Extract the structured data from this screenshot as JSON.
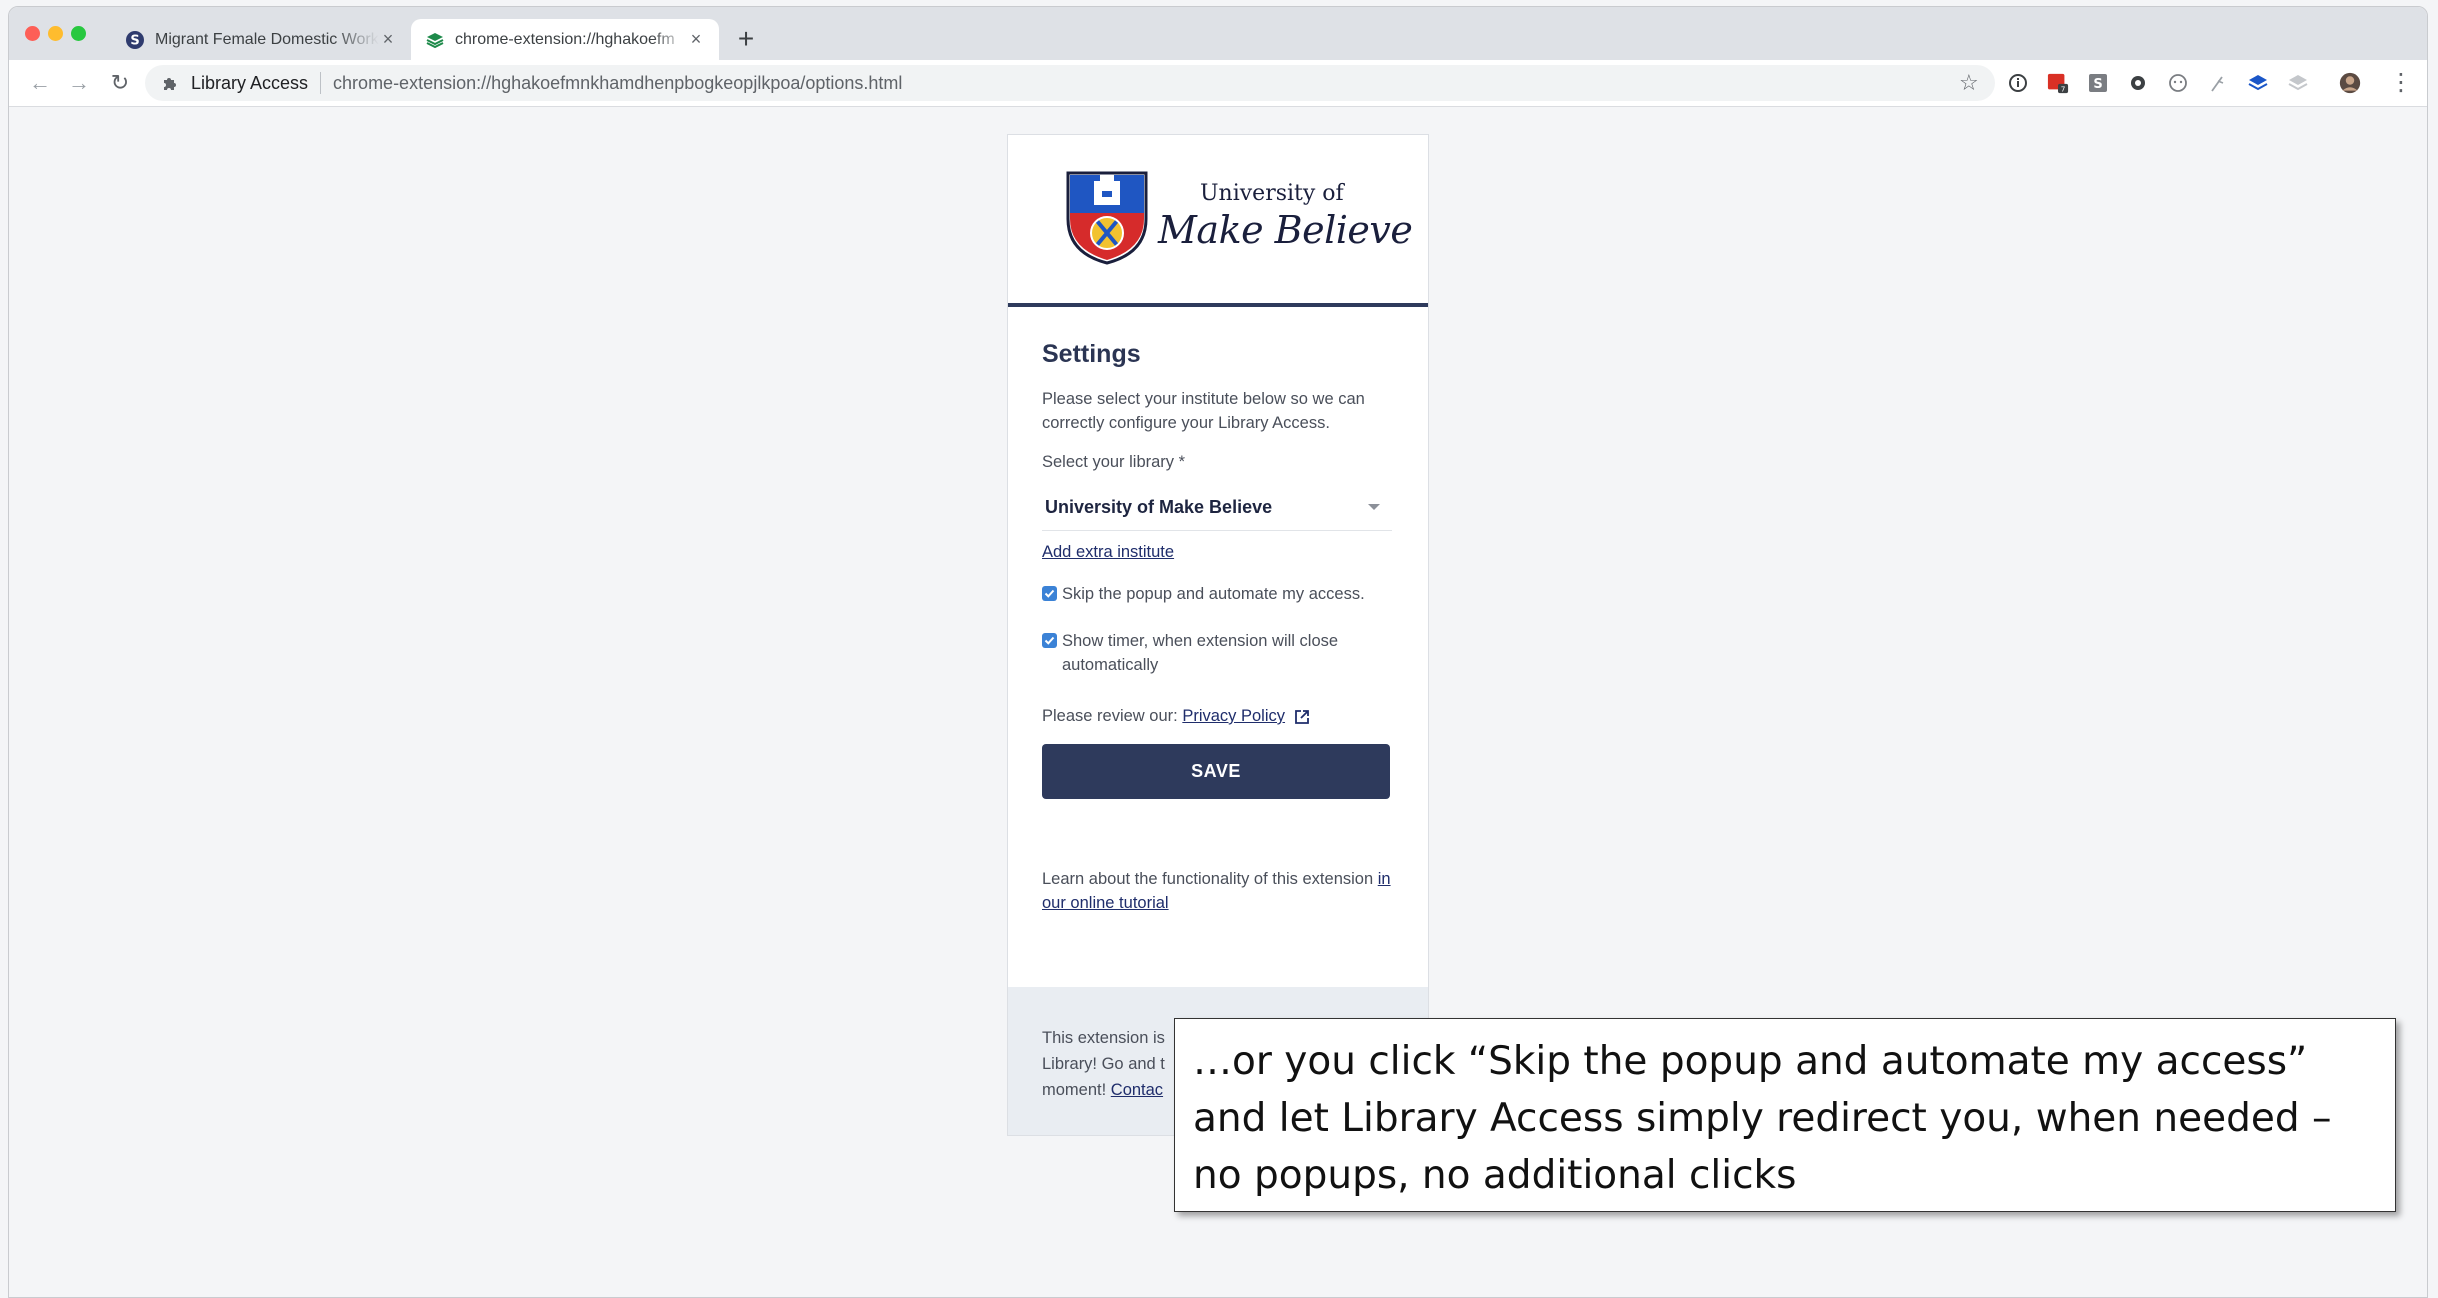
{
  "browser": {
    "tabs": [
      {
        "title": "Migrant Female Domestic Work",
        "active": false
      },
      {
        "title": "chrome-extension://hghakoefm",
        "active": true
      }
    ],
    "new_tab": "+",
    "close_glyph": "×",
    "omnibox": {
      "origin": "Library Access",
      "url": "chrome-extension://hghakoefmnkhamdhenpbogkeopjlkpoa/options.html"
    },
    "extension_icons": [
      "info-icon",
      "pdf-badge-icon",
      "s-square-icon",
      "circle-icon",
      "face-icon",
      "feather-icon",
      "stack-blue-icon",
      "stack-gray-icon"
    ],
    "pdf_badge_count": "7"
  },
  "logo": {
    "line1": "University of",
    "line2": "Make Believe"
  },
  "settings": {
    "title": "Settings",
    "description": "Please select your institute below so we can correctly configure your Library Access.",
    "select_label": "Select your library *",
    "selected_library": "University of Make Believe",
    "add_extra": "Add extra institute",
    "skip_popup": "Skip the popup and automate my access.",
    "show_timer": "Show timer, when extension will close automatically",
    "policy_prefix": "Please review our: ",
    "policy_link": "Privacy Policy",
    "save": "SAVE",
    "learn_prefix": "Learn about the functionality of this extension ",
    "learn_link": "in our online tutorial"
  },
  "footer": {
    "line1": "This extension is",
    "line2": "Library! Go and t",
    "line3_prefix": "moment! ",
    "line3_link": "Contac"
  },
  "callout": {
    "text": "…or you click “Skip the popup and automate my access” and let Library Access simply redirect you, when needed – no popups, no additional clicks"
  },
  "colors": {
    "navy": "#2e3a5c",
    "checkbox": "#3b82d6",
    "crest_red": "#d62b2b",
    "crest_blue": "#1f56c2"
  }
}
